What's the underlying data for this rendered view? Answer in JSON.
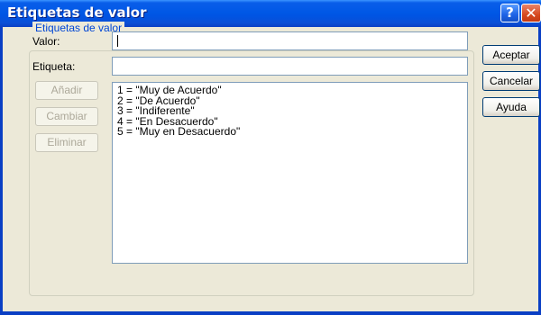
{
  "window": {
    "title": "Etiquetas de valor",
    "help_label": "?",
    "close_label": "✕"
  },
  "group": {
    "legend": "Etiquetas de valor"
  },
  "fields": {
    "value_label": "Valor:",
    "value_text": "",
    "tag_label": "Etiqueta:",
    "tag_text": ""
  },
  "side_buttons": {
    "add": "Añadir",
    "change": "Cambiar",
    "remove": "Eliminar"
  },
  "list": {
    "items": [
      "1 = \"Muy de Acuerdo\"",
      "2 = \"De Acuerdo\"",
      "3 = \"Indiferente\"",
      "4 = \"En Desacuerdo\"",
      "5 = \"Muy en Desacuerdo\""
    ]
  },
  "actions": {
    "accept": "Aceptar",
    "cancel": "Cancelar",
    "help": "Ayuda"
  }
}
